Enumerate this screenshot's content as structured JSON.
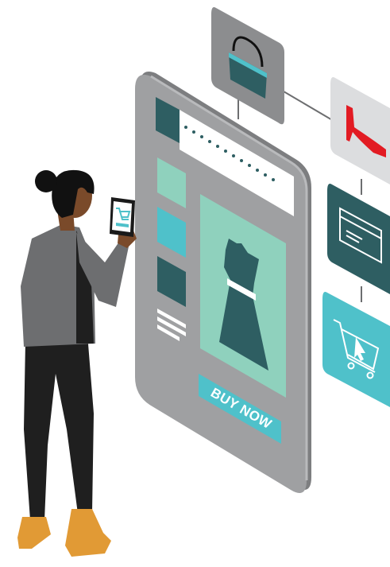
{
  "phone_screen": {
    "buy_button_label": "BUY NOW"
  },
  "tiles": [
    {
      "icon": "handbag-icon"
    },
    {
      "icon": "high-heel-shoe-icon"
    },
    {
      "icon": "credit-card-icon"
    },
    {
      "icon": "shopping-cart-icon"
    }
  ],
  "colors": {
    "device_body": "#8c8d8f",
    "device_screen": "#9fa0a2",
    "dark_teal": "#2e5e62",
    "mint": "#8fd1bd",
    "cyan": "#4fc1ca",
    "shoe_red": "#e21b23",
    "skin": "#7a4a2a",
    "hair": "#111111",
    "sweater": "#6d6e70",
    "pants": "#1f1f1f",
    "shoes": "#e19a35"
  }
}
